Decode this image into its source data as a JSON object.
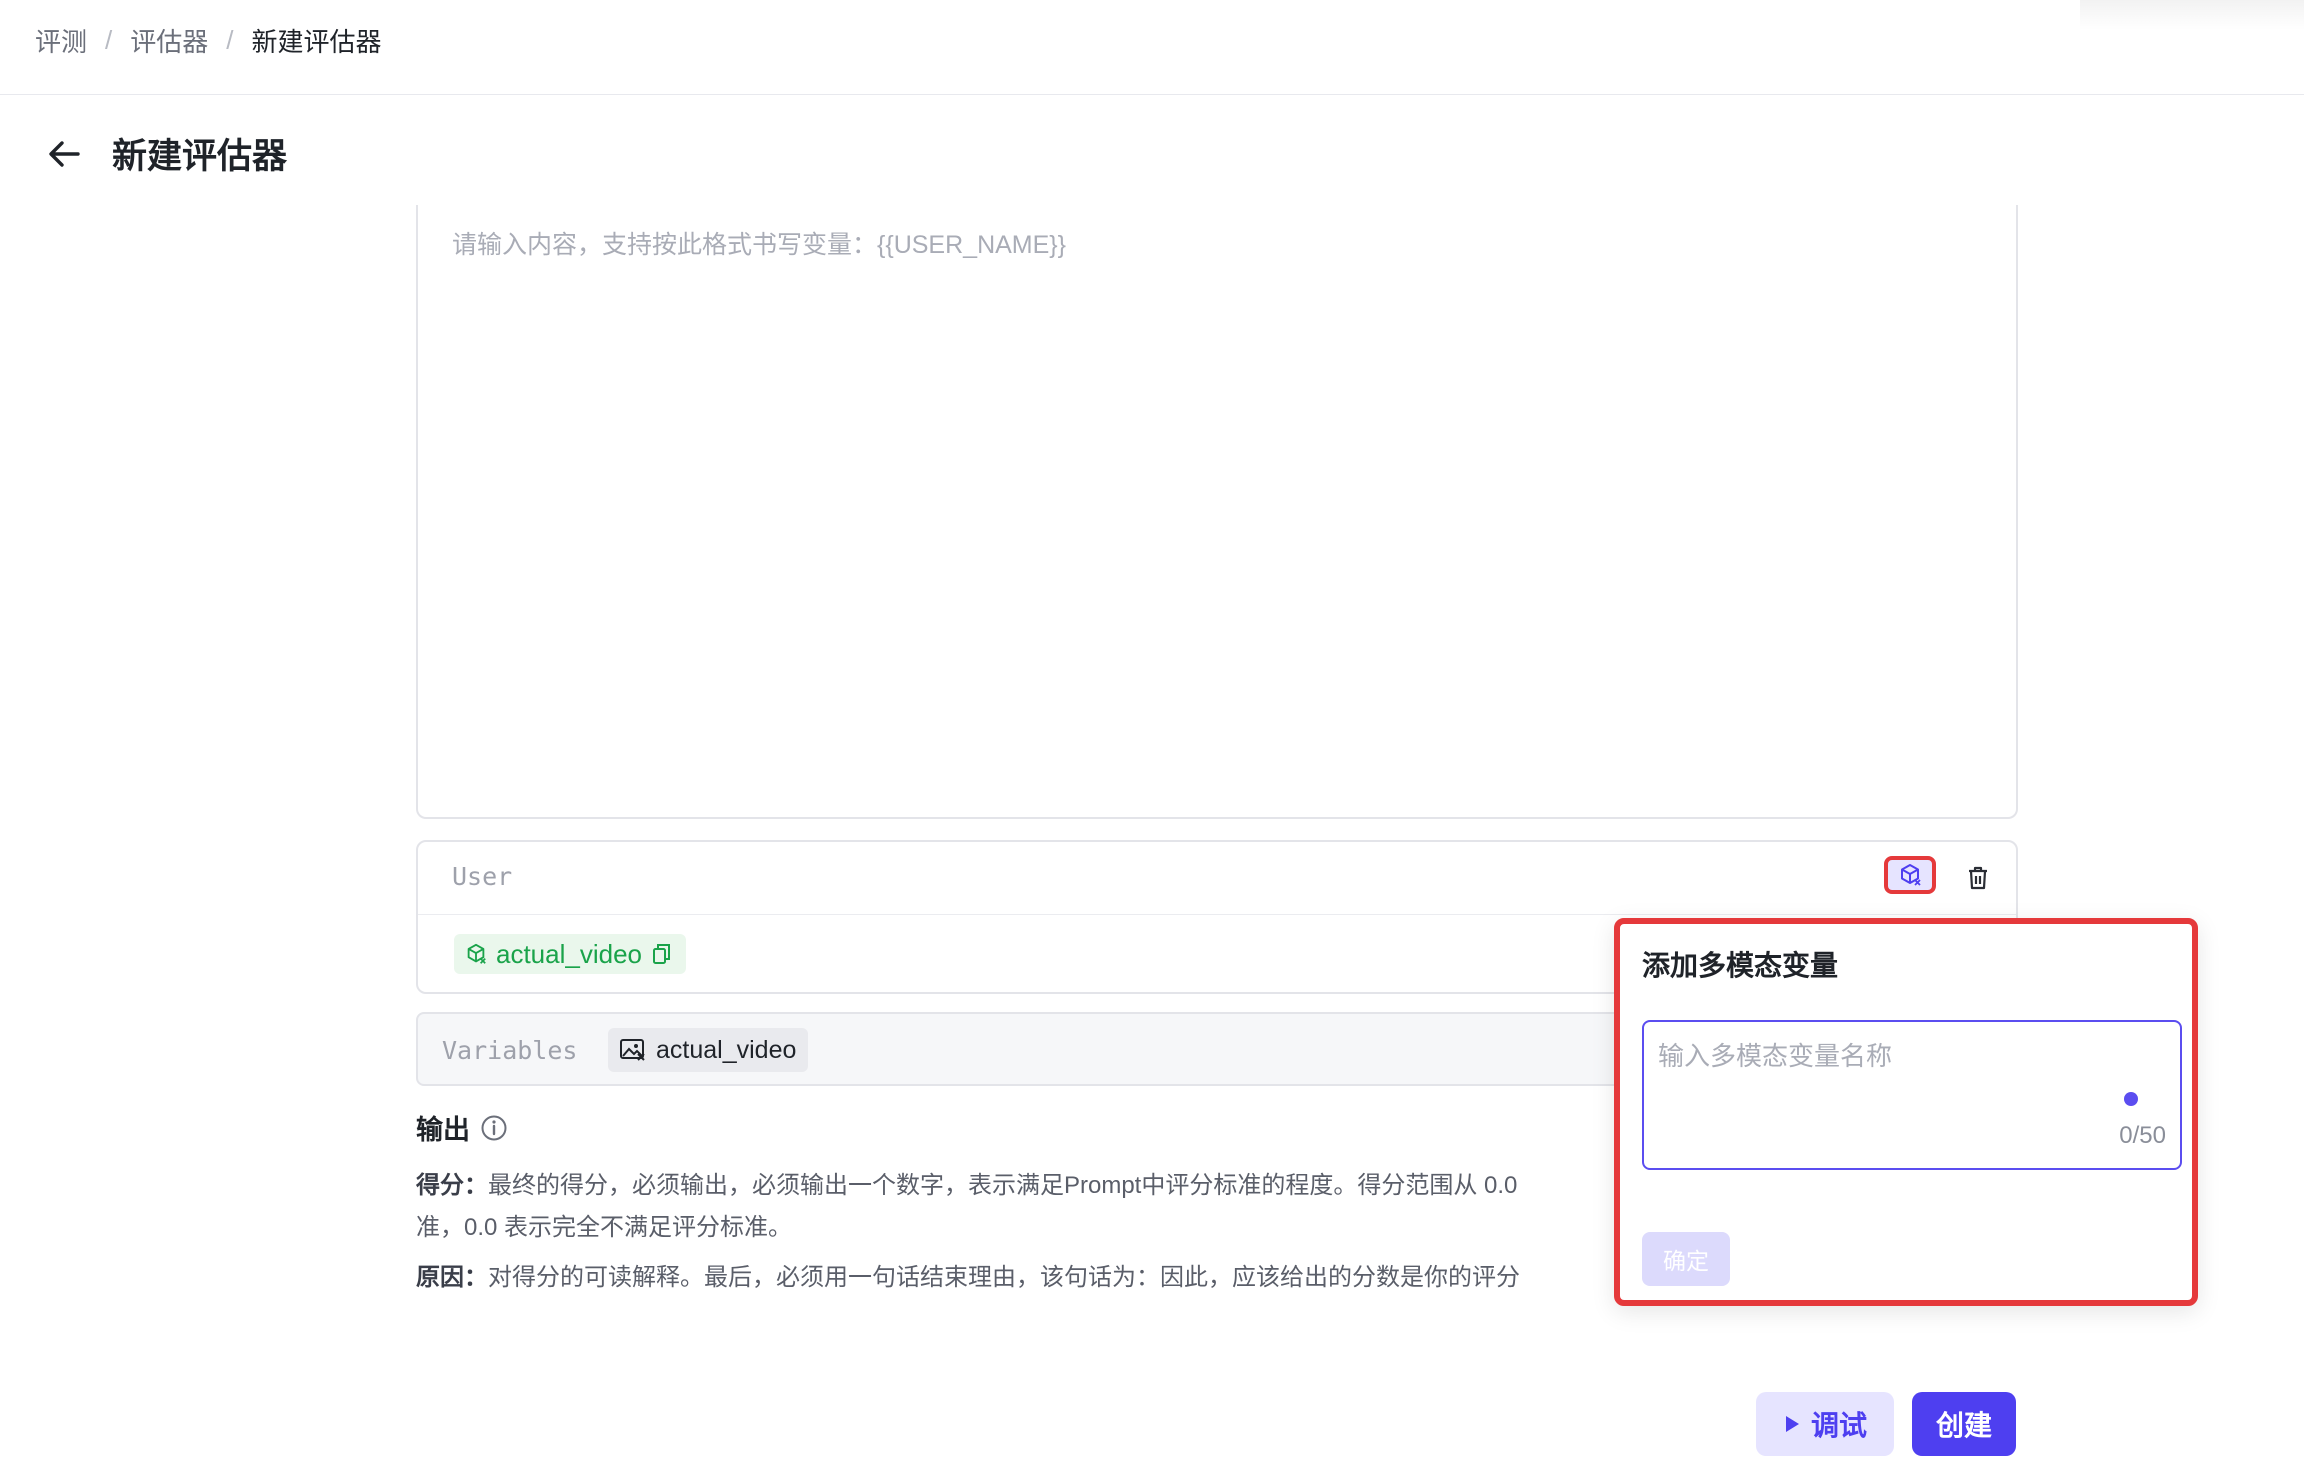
{
  "breadcrumb": {
    "items": [
      "评测",
      "评估器",
      "新建评估器"
    ],
    "separator": "/"
  },
  "page": {
    "title": "新建评估器"
  },
  "editor": {
    "placeholder": "请输入内容，支持按此格式书写变量：{{USER_NAME}}"
  },
  "user_message": {
    "role_label": "User",
    "variable_chip": "actual_video"
  },
  "variables_bar": {
    "label": "Variables",
    "chip": "actual_video"
  },
  "output": {
    "title": "输出",
    "score_label": "得分：",
    "score_text": "最终的得分，必须输出，必须输出一个数字，表示满足Prompt中评分标准的程度。得分范围从 0.0",
    "score_text_2": "准，0.0 表示完全不满足评分标准。",
    "reason_label": "原因：",
    "reason_text": "对得分的可读解释。最后，必须用一句话结束理由，该句话为：因此，应该给出的分数是你的评分"
  },
  "popover": {
    "title": "添加多模态变量",
    "input_placeholder": "输入多模态变量名称",
    "counter": "0/50",
    "confirm_label": "确定"
  },
  "footer": {
    "debug_label": "调试",
    "create_label": "创建"
  },
  "colors": {
    "accent": "#4e3ff0",
    "highlight": "#e5393b",
    "variable_green": "#1aa34a"
  },
  "icons": [
    "arrow-left-icon",
    "multimodal-cube-icon",
    "trash-icon",
    "copy-icon",
    "image-icon",
    "info-icon",
    "play-icon"
  ]
}
